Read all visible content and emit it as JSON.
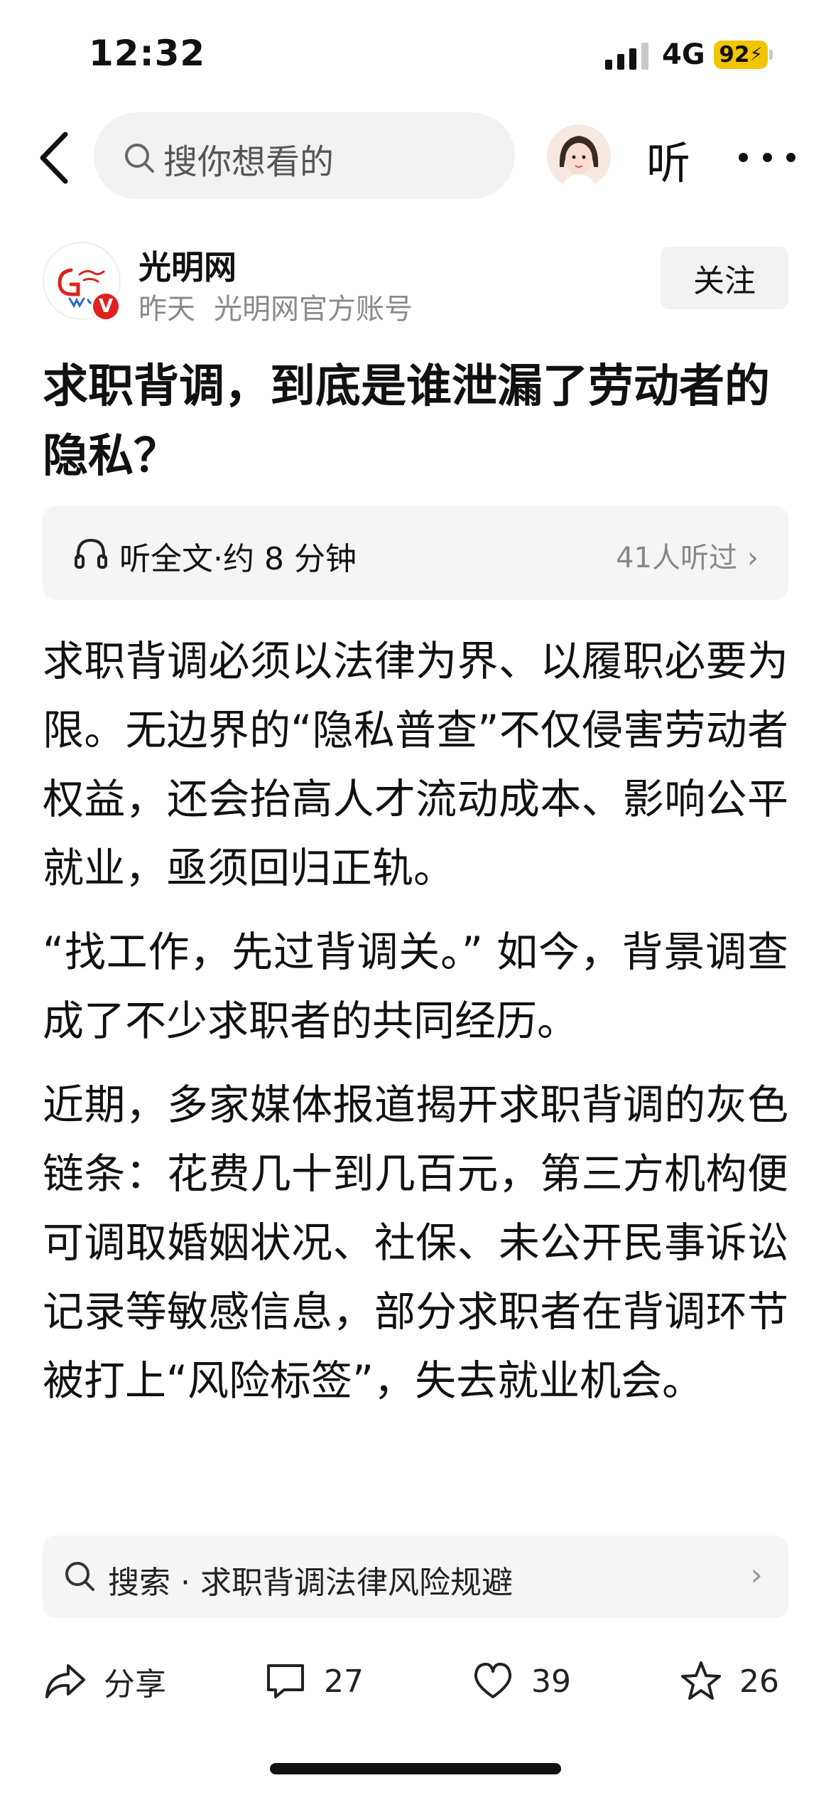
{
  "status_bar": {
    "time": "12:32",
    "network": "4G",
    "battery": "92"
  },
  "nav": {
    "search_placeholder": "搜你想看的",
    "listen_label": "听"
  },
  "author": {
    "name": "光明网",
    "date": "昨天",
    "account_desc": "光明网官方账号",
    "follow_label": "关注",
    "badge": "V"
  },
  "article": {
    "title": "求职背调，到底是谁泄漏了劳动者的隐私？",
    "listen": {
      "label": "听全文·约 8 分钟",
      "count": "41人听过",
      "chevron": "›"
    },
    "paragraphs": [
      "求职背调必须以法律为界、以履职必要为限。无边界的“隐私普查”不仅侵害劳动者权益，还会抬高人才流动成本、影响公平就业，亟须回归正轨。",
      "“找工作，先过背调关。” 如今，背景调查成了不少求职者的共同经历。",
      "近期，多家媒体报道揭开求职背调的灰色链条：花费几十到几百元，第三方机构便可调取婚姻状况、社保、未公开民事诉讼记录等敏感信息，部分求职者在背调环节被打上“风险标签”，失去就业机会。"
    ]
  },
  "related_search": {
    "text": "搜索 · 求职背调法律风险规避",
    "chevron": "›"
  },
  "actions": {
    "share": "分享",
    "comments": "27",
    "likes": "39",
    "favorites": "26"
  },
  "colors": {
    "battery": "#f2c500",
    "badge": "#e02020",
    "logo_red": "#d8261c"
  }
}
